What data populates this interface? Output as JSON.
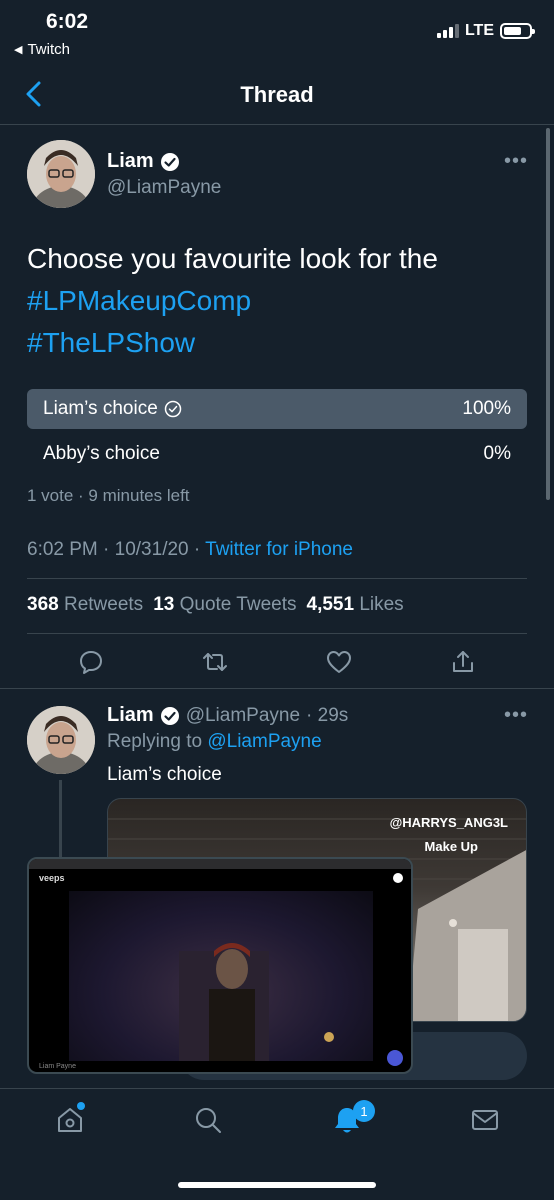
{
  "status_bar": {
    "time": "6:02",
    "back_app": "Twitch",
    "network": "LTE"
  },
  "nav": {
    "title": "Thread"
  },
  "tweet": {
    "author_name": "Liam",
    "author_handle": "@LiamPayne",
    "text": "Choose you favourite look for the",
    "hashtags": [
      "#LPMakeupComp",
      "#TheLPShow"
    ],
    "poll": {
      "options": [
        {
          "label": "Liam’s choice",
          "percent": "100%",
          "winner": true
        },
        {
          "label": "Abby’s choice",
          "percent": "0%",
          "winner": false
        }
      ],
      "meta": "1 vote · 9 minutes left"
    },
    "timestamp": "6:02 PM · 10/31/20 · ",
    "source": "Twitter for iPhone",
    "stats": {
      "retweets_count": "368",
      "retweets_label": "Retweets",
      "quotes_count": "13",
      "quotes_label": "Quote Tweets",
      "likes_count": "4,551",
      "likes_label": "Likes"
    }
  },
  "reply": {
    "author_name": "Liam",
    "author_handle": "@LiamPayne",
    "time": "· 29s",
    "replying_prefix": "Replying to ",
    "replying_to": "@LiamPayne",
    "text": "Liam’s choice",
    "media": {
      "overlay_line1": "@HARRYS_ANG3L",
      "overlay_line2": "Make Up"
    }
  },
  "pip": {
    "site_label": "veeps",
    "caption": "Liam Payne"
  },
  "tabbar": {
    "notifications_badge": "1"
  },
  "colors": {
    "background": "#15202b",
    "accent": "#1da1f2",
    "muted": "#8899a6",
    "divider": "#38444d",
    "poll_winner": "#4b5a69"
  }
}
